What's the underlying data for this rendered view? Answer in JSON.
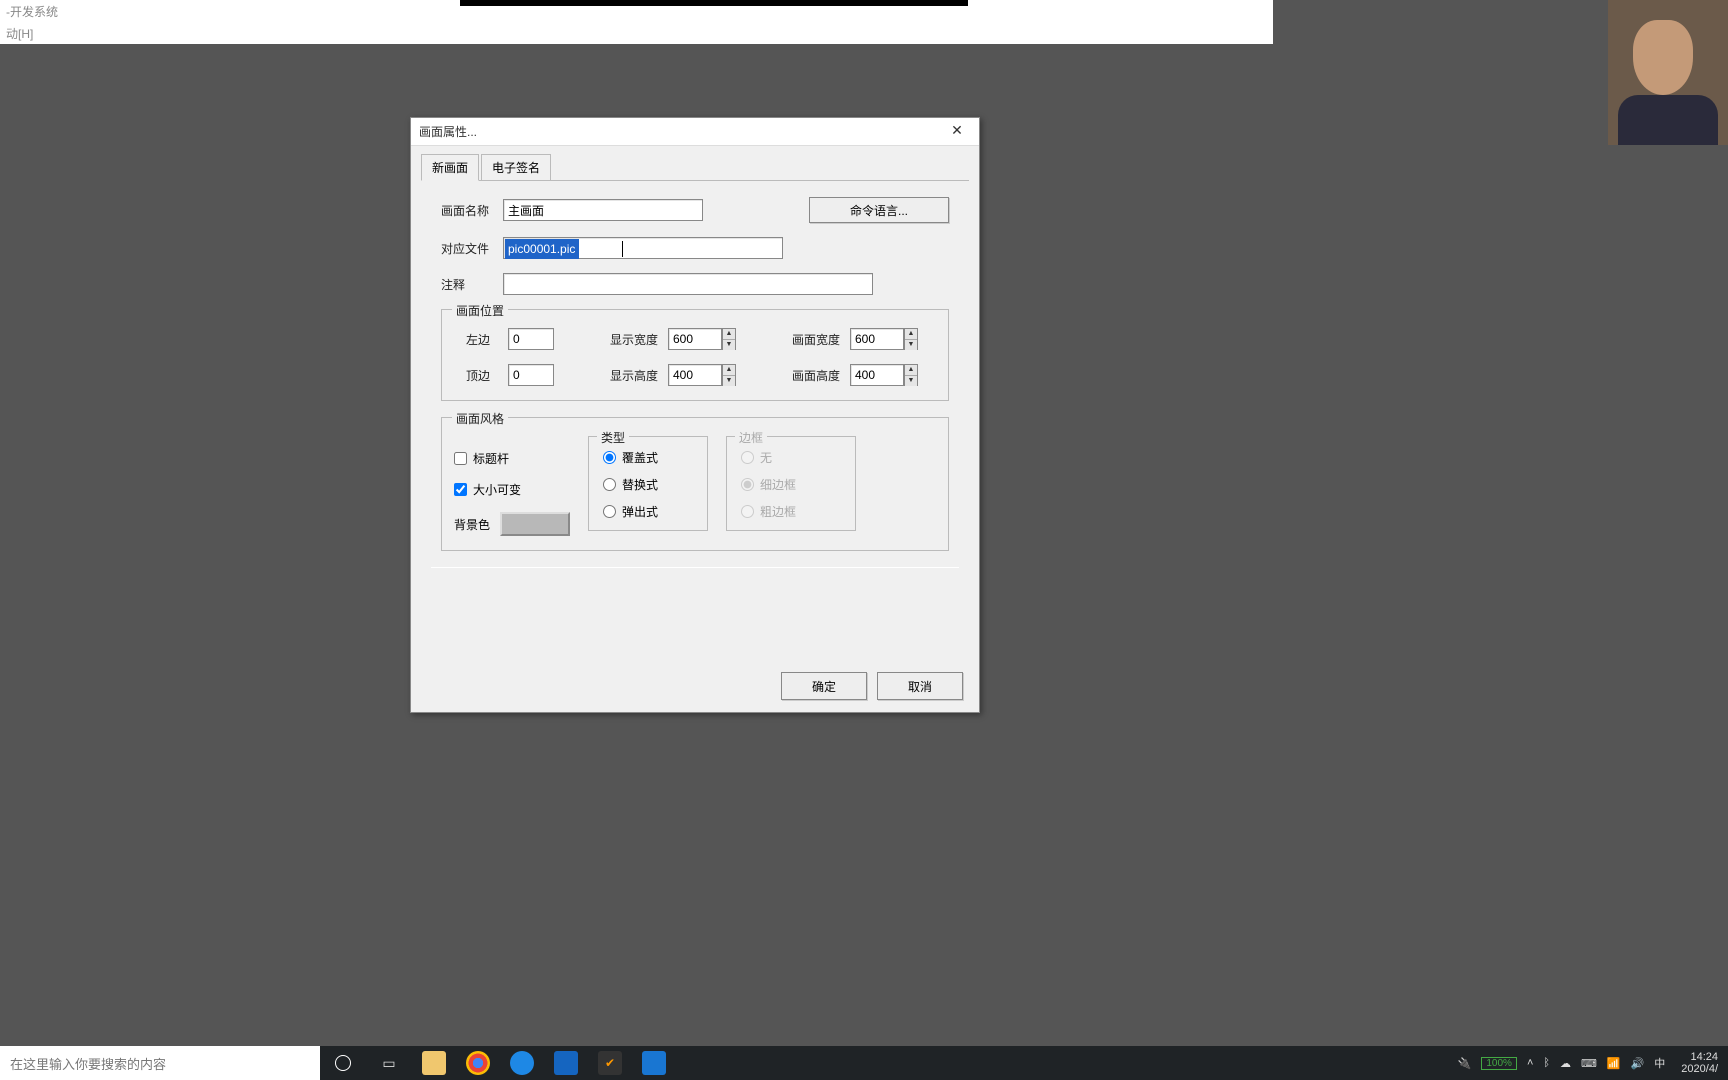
{
  "app": {
    "title_suffix": "-开发系统",
    "menu_item": "动[H]"
  },
  "dialog": {
    "title": "画面属性...",
    "tabs": {
      "new_screen": "新画面",
      "esign": "电子签名"
    },
    "labels": {
      "screen_name": "画面名称",
      "file": "对应文件",
      "comment": "注释",
      "cmd_lang": "命令语言..."
    },
    "values": {
      "screen_name": "主画面",
      "file": "pic00001.pic",
      "comment": ""
    },
    "position": {
      "legend": "画面位置",
      "left_label": "左边",
      "left": "0",
      "top_label": "顶边",
      "top": "0",
      "disp_w_label": "显示宽度",
      "disp_w": "600",
      "disp_h_label": "显示高度",
      "disp_h": "400",
      "screen_w_label": "画面宽度",
      "screen_w": "600",
      "screen_h_label": "画面高度",
      "screen_h": "400"
    },
    "style": {
      "legend": "画面风格",
      "titlebar": "标题杆",
      "resizable": "大小可变",
      "bgcolor": "背景色",
      "type_legend": "类型",
      "type_options": {
        "cover": "覆盖式",
        "replace": "替换式",
        "popup": "弹出式"
      },
      "border_legend": "边框",
      "border_options": {
        "none": "无",
        "thin": "细边框",
        "thick": "粗边框"
      }
    },
    "buttons": {
      "ok": "确定",
      "cancel": "取消"
    }
  },
  "taskbar": {
    "search_placeholder": "在这里输入你要搜索的内容",
    "battery": "100%",
    "ime": "中",
    "time": "14:24",
    "date": "2020/4/"
  }
}
